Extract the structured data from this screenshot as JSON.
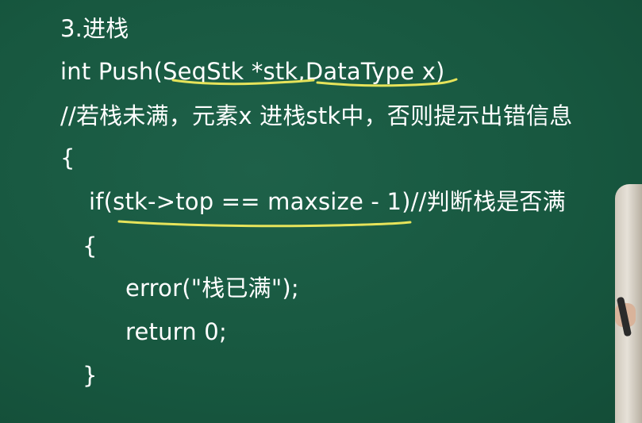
{
  "slide": {
    "heading": "3.进栈",
    "code_lines": [
      "int Push(SeqStk *stk,DataType x)",
      "//若栈未满，元素x 进栈stk中，否则提示出错信息",
      "{",
      "if(stk->top == maxsize - 1)//判断栈是否满",
      "{",
      "error(\"栈已满\");",
      "return 0;",
      "}"
    ]
  },
  "colors": {
    "board": "#1a5a44",
    "text": "#ffffff",
    "annotation": "#e6e35a"
  },
  "icons": {
    "presenter": "presenter-arm"
  }
}
